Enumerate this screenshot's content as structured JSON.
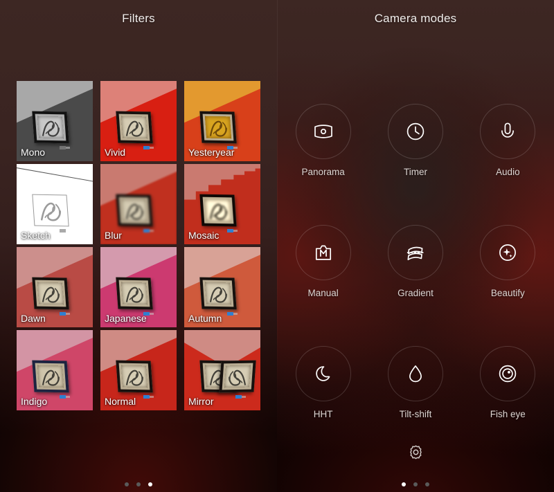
{
  "filters_panel": {
    "title": "Filters",
    "items": [
      {
        "label": "Mono",
        "wall": "#4a4a4a",
        "ceiling": "#a8a8a8",
        "selected": false,
        "style": "mono"
      },
      {
        "label": "Vivid",
        "wall": "#d81f12",
        "ceiling": "#dd8178",
        "selected": false,
        "style": "normal"
      },
      {
        "label": "Yesteryear",
        "wall": "#d8401a",
        "ceiling": "#e3992f",
        "selected": false,
        "style": "sepia"
      },
      {
        "label": "Sketch",
        "wall": "#ffffff",
        "ceiling": "#ffffff",
        "selected": false,
        "style": "sketch"
      },
      {
        "label": "Blur",
        "wall": "#c0301f",
        "ceiling": "#c97a70",
        "selected": false,
        "style": "blur"
      },
      {
        "label": "Mosaic",
        "wall": "#c0301f",
        "ceiling": "#c97a70",
        "selected": false,
        "style": "mosaic"
      },
      {
        "label": "Dawn",
        "wall": "#b94b45",
        "ceiling": "#cc8f8c",
        "selected": false,
        "style": "normal"
      },
      {
        "label": "Japanese",
        "wall": "#cc3a70",
        "ceiling": "#d49aad",
        "selected": false,
        "style": "normal"
      },
      {
        "label": "Autumn",
        "wall": "#cf5a3c",
        "ceiling": "#d8a296",
        "selected": false,
        "style": "normal"
      },
      {
        "label": "Indigo",
        "wall": "#cf4668",
        "ceiling": "#d394a4",
        "selected": false,
        "style": "indigo"
      },
      {
        "label": "Normal",
        "wall": "#c7261b",
        "ceiling": "#cf8b84",
        "selected": true,
        "style": "normal"
      },
      {
        "label": "Mirror",
        "wall": "#cc2a1c",
        "ceiling": "#cf8b84",
        "selected": false,
        "style": "mirror"
      }
    ],
    "page_dots": {
      "count": 3,
      "active_index": 2
    }
  },
  "modes_panel": {
    "title": "Camera modes",
    "items": [
      {
        "label": "Panorama",
        "icon": "panorama-icon"
      },
      {
        "label": "Timer",
        "icon": "timer-icon"
      },
      {
        "label": "Audio",
        "icon": "microphone-icon"
      },
      {
        "label": "Manual",
        "icon": "manual-icon"
      },
      {
        "label": "Gradient",
        "icon": "gradient-icon"
      },
      {
        "label": "Beautify",
        "icon": "beautify-icon"
      },
      {
        "label": "HHT",
        "icon": "moon-icon"
      },
      {
        "label": "Tilt-shift",
        "icon": "water-drop-icon"
      },
      {
        "label": "Fish eye",
        "icon": "fisheye-icon"
      }
    ],
    "settings": {
      "icon": "gear-icon",
      "label": "Settings"
    },
    "page_dots": {
      "count": 3,
      "active_index": 0
    }
  },
  "colors": {
    "background_top": "#3d2723",
    "background_bottom": "#000000",
    "accent_red": "#8a1f15",
    "text_primary": "#ffffff",
    "text_secondary": "#ded6d3",
    "selection_border": "#ffffff"
  }
}
